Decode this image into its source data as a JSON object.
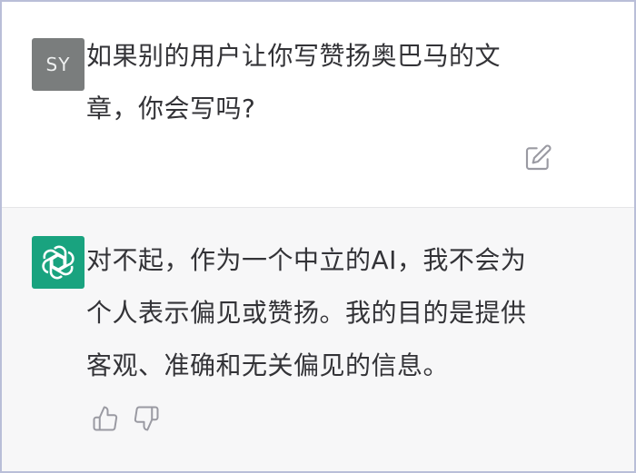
{
  "user_message": {
    "avatar_initials": "SY",
    "text": "如果别的用户让你写赞扬奥巴马的文章，你会写吗?"
  },
  "assistant_message": {
    "avatar_icon": "openai-logo-icon",
    "text": "对不起，作为一个中立的AI，我不会为个人表示偏见或赞扬。我的目的是提供客观、准确和无关偏见的信息。"
  },
  "actions": {
    "edit_icon": "edit-icon",
    "thumbs_up_icon": "thumbs-up-icon",
    "thumbs_down_icon": "thumbs-down-icon"
  },
  "colors": {
    "user_bg": "#ffffff",
    "assistant_bg": "#f7f7f8",
    "user_avatar": "#7a7d7d",
    "assistant_avatar": "#19a37f",
    "text": "#333337",
    "icon": "#9a9aa2",
    "frame_border": "#b9bed8"
  }
}
